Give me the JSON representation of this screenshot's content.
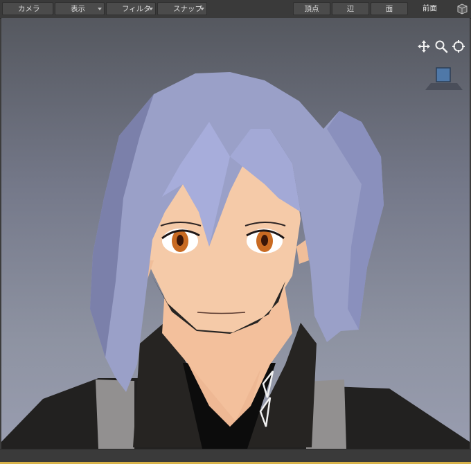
{
  "toolbar": {
    "camera_label": "カメラ",
    "display_label": "表示",
    "filter_label": "フィルタ",
    "snap_label": "スナップ",
    "vertex_label": "頂点",
    "edge_label": "辺",
    "face_label": "面",
    "view_name": "前面",
    "icons": [
      "dropdown-arrow-icon",
      "view-cube-icon"
    ]
  },
  "viewport": {
    "icons": [
      "move-icon",
      "zoom-icon",
      "orbit-icon"
    ],
    "gizmo_icon": "orientation-gizmo-icon"
  },
  "colors": {
    "toolbar_bg": "#3a3a3a",
    "button_bg": "#4b4b4b",
    "viewport_top": "#55585f",
    "viewport_bottom": "#999db0",
    "hair": "#9aa0c8",
    "skin": "#f6c9a6",
    "jacket": "#2a2826",
    "accent": "#d8b34a"
  }
}
